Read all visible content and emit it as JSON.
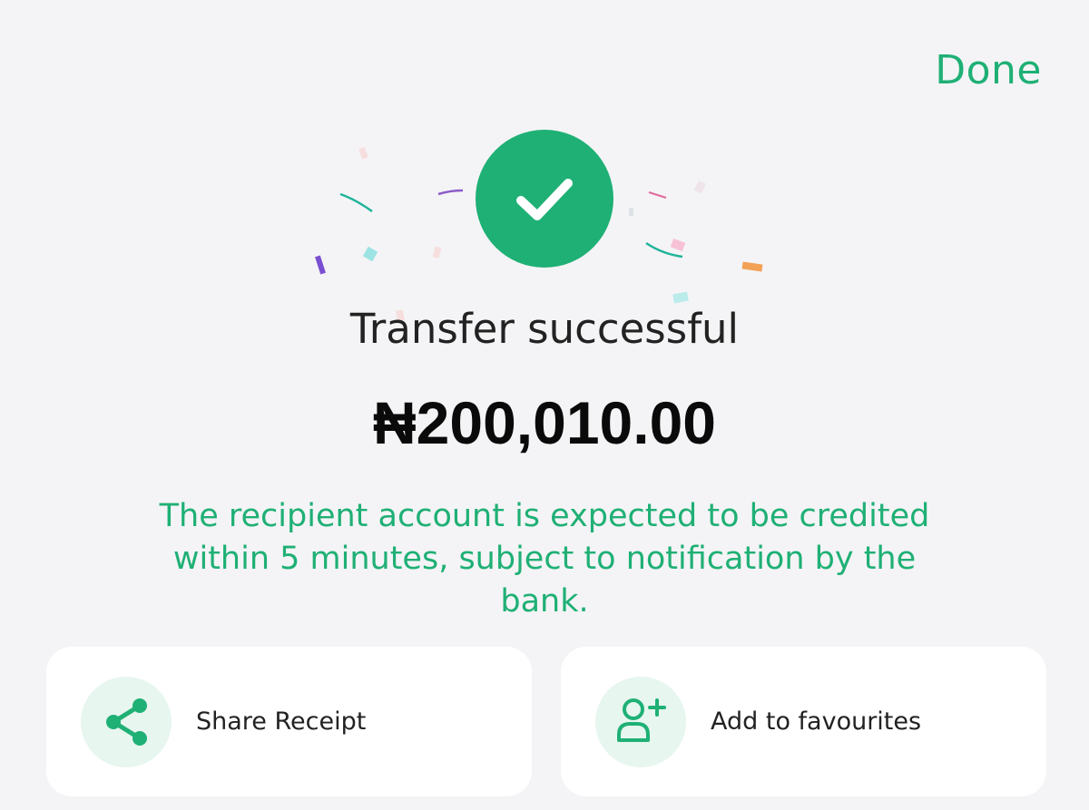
{
  "header": {
    "done_label": "Done"
  },
  "status": {
    "icon": "check-icon",
    "title": "Transfer successful",
    "amount": "₦200,010.00",
    "note": "The recipient account is expected to be credited within 5 minutes, subject to notification by the bank."
  },
  "actions": [
    {
      "label": "Share Receipt",
      "icon": "share-icon"
    },
    {
      "label": "Add to favourites",
      "icon": "add-user-icon"
    }
  ],
  "colors": {
    "accent": "#1fb075",
    "accent_light": "#e7f6ef",
    "background": "#f4f4f6",
    "card": "#ffffff",
    "text": "#222222"
  }
}
